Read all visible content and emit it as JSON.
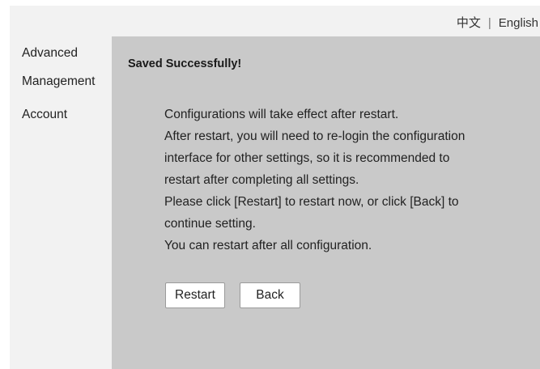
{
  "header": {
    "lang_chinese": "中文",
    "lang_separator": "|",
    "lang_english": "English"
  },
  "sidebar": {
    "items": [
      {
        "label": "Advanced"
      },
      {
        "label": "Management"
      },
      {
        "label": "Account"
      }
    ]
  },
  "main": {
    "title": "Saved Successfully!",
    "message_lines": [
      "Configurations will take effect after restart.",
      "After restart, you will need to re-login the configuration",
      "interface for other settings, so it is recommended to",
      "restart after completing all settings.",
      "Please click [Restart] to restart now, or click [Back] to",
      "continue setting.",
      "You can restart after all configuration."
    ],
    "restart_label": "Restart",
    "back_label": "Back"
  },
  "colors": {
    "content_background": "#c9c9c9",
    "sidebar_background": "#f2f2f2",
    "button_background": "#ffffff"
  }
}
